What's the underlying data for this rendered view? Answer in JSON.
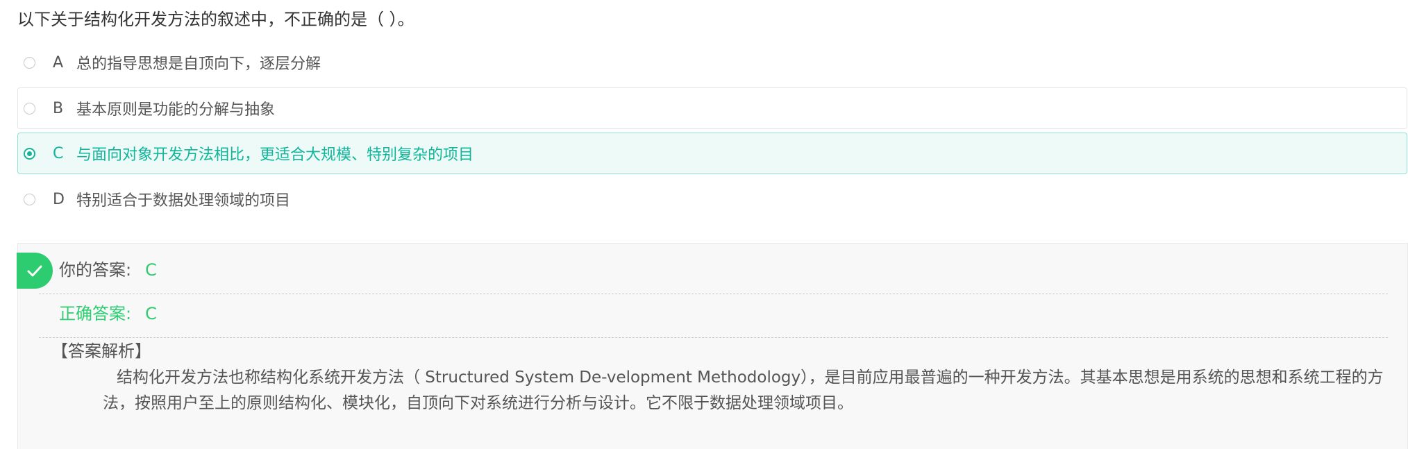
{
  "question": {
    "text": "以下关于结构化开发方法的叙述中，不正确的是（ ）。"
  },
  "options": [
    {
      "letter": "A",
      "text": "总的指导思想是自顶向下，逐层分解",
      "selected": false
    },
    {
      "letter": "B",
      "text": "基本原则是功能的分解与抽象",
      "selected": false
    },
    {
      "letter": "C",
      "text": "与面向对象开发方法相比，更适合大规模、特别复杂的项目",
      "selected": true
    },
    {
      "letter": "D",
      "text": "特别适合于数据处理领域的项目",
      "selected": false
    }
  ],
  "result": {
    "status_icon": "check-icon",
    "your_answer_label": "你的答案:",
    "your_answer_value": "C",
    "correct_answer_label": "正确答案:",
    "correct_answer_value": "C",
    "analysis_title": "【答案解析】",
    "analysis_text": "结构化开发方法也称结构化系统开发方法（ Structured System De-velopment Methodology），是目前应用最普遍的一种开发方法。其基本思想是用系统的思想和系统工程的方法，按照用户至上的原则结构化、模块化，自顶向下对系统进行分析与设计。它不限于数据处理领域项目。"
  },
  "colors": {
    "accent_teal": "#12b59a",
    "correct_green": "#2ecc71",
    "selected_bg": "#eefaf7",
    "panel_bg": "#f8f8f8"
  }
}
